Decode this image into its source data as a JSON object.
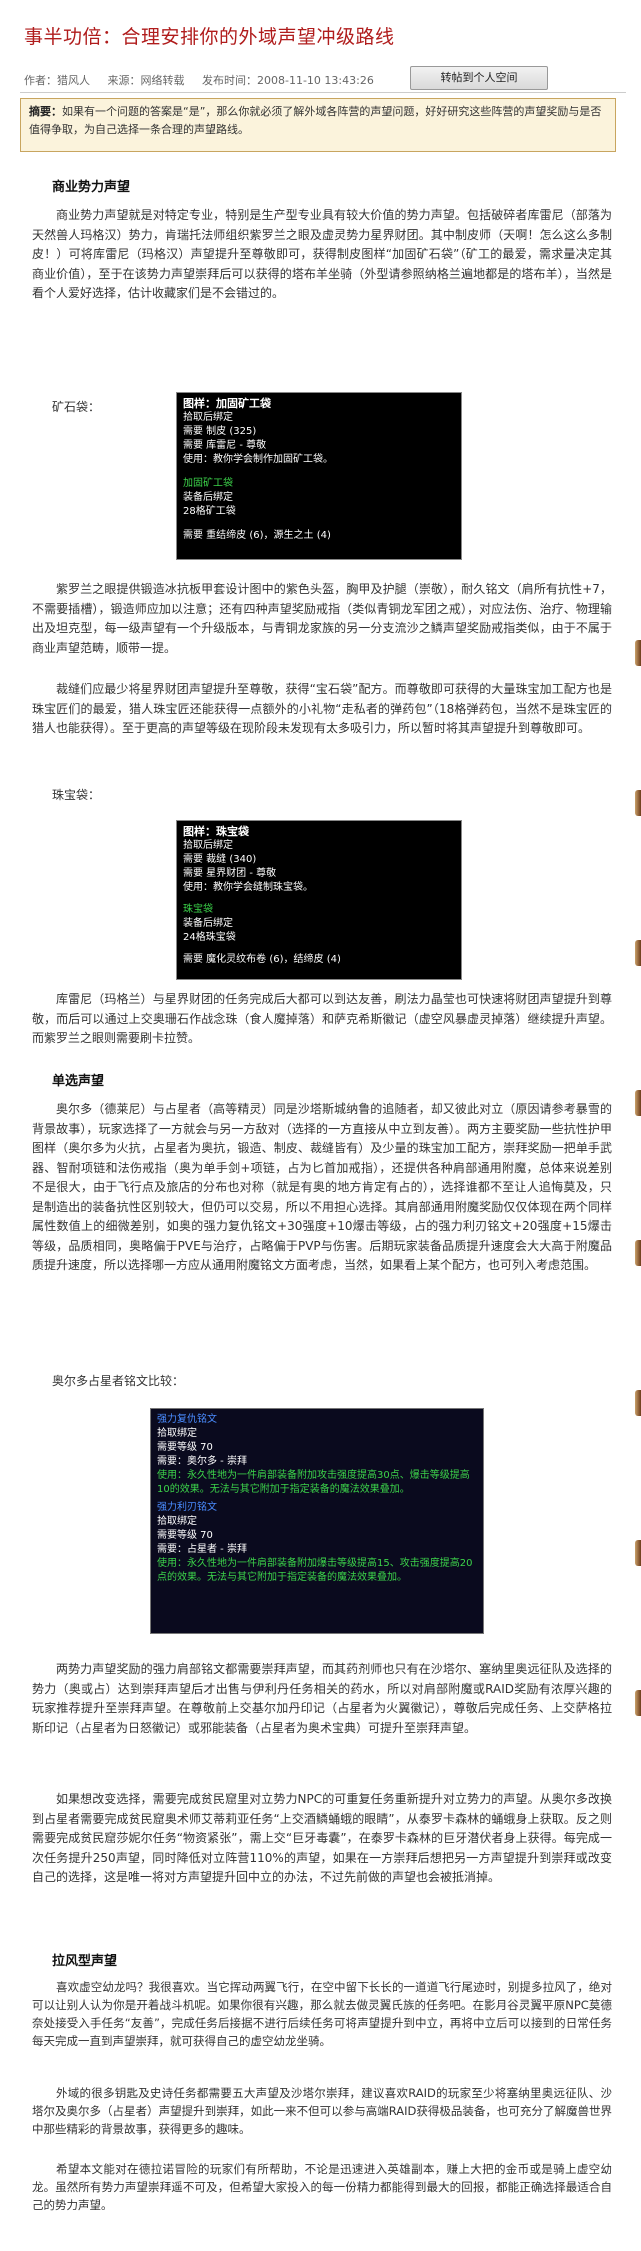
{
  "title": "事半功倍：合理安排你的外域声望冲级路线",
  "meta": {
    "author": "作者：猎风人",
    "source": "来源：网络转载",
    "time": "发布时间：2008-11-10 13:43:26",
    "save_button": "转帖到个人空间"
  },
  "summary": {
    "label": "摘要：",
    "text": "如果有一个问题的答案是“是”，那么你就必须了解外域各阵营的声望问题，好好研究这些阵营的声望奖励与是否值得争取，为自己选择一条合理的声望路线。"
  },
  "sections": {
    "business_heading": "商业势力声望",
    "business_p1": "商业势力声望就是对特定专业，特别是生产型专业具有较大价值的势力声望。包括破碎者库雷尼（部落为天然兽人玛格汉）势力，肯瑞托法师组织紫罗兰之眼及虚灵势力星界财团。其中制皮师（天啊！怎么这么多制皮！）可将库雷尼（玛格汉）声望提升至尊敬即可，获得制皮图样“加固矿石袋”（矿工的最爱，需求量决定其商业价值），至于在该势力声望崇拜后可以获得的塔布羊坐骑（外型请参照纳格兰遍地都是的塔布羊），当然是看个人爱好选择，估计收藏家们是不会错过的。",
    "ore_bag_label": "矿石袋：",
    "tip1": {
      "title": "图样：加固矿工袋",
      "l1": "拾取后绑定",
      "l2": "需要 制皮 (325)",
      "l3": "需要 库雷尼 - 尊敬",
      "l4": "使用：教你学会制作加固矿工袋。",
      "g1": "加固矿工袋",
      "g2": "装备后绑定",
      "g3": "28格矿工袋",
      "l5": "需要 重结缔皮 (6)，源生之土 (4)"
    },
    "business_p2": "紫罗兰之眼提供锻造冰抗板甲套设计图中的紫色头盔，胸甲及护腿（崇敬），耐久铭文（肩所有抗性+7，不需要插槽），锻造师应加以注意；还有四种声望奖励戒指（类似青铜龙军团之戒），对应法伤、治疗、物理输出及坦克型，每一级声望有一个升级版本，与青铜龙家族的另一分支流沙之鳞声望奖励戒指类似，由于不属于商业声望范畴，顺带一提。",
    "business_p3": "裁缝们应最少将星界财团声望提升至尊敬，获得“宝石袋”配方。而尊敬即可获得的大量珠宝加工配方也是珠宝匠们的最爱，猎人珠宝匠还能获得一点额外的小礼物“走私者的弹药包”（18格弹药包，当然不是珠宝匠的猎人也能获得）。至于更高的声望等级在现阶段未发现有太多吸引力，所以暂时将其声望提升到尊敬即可。",
    "gem_bag_label": "珠宝袋：",
    "tip2": {
      "title": "图样：珠宝袋",
      "l1": "拾取后绑定",
      "l2": "需要 裁缝 (340)",
      "l3": "需要 星界财团 - 尊敬",
      "l4": "使用：教你学会缝制珠宝袋。",
      "g1": "珠宝袋",
      "g2": "装备后绑定",
      "g3": "24格珠宝袋",
      "l5": "需要 魔化灵纹布卷 (6)，结缔皮 (4)"
    },
    "business_p4": "库雷尼（玛格兰）与星界财团的任务完成后大都可以到达友善，刷法力晶莹也可快速将财团声望提升到尊敬，而后可以通过上交奥珊石作战念珠（食人魔掉落）和萨克希斯徽记（虚空风暴虚灵掉落）继续提升声望。而紫罗兰之眼则需要刷卡拉赞。",
    "single_heading": "单选声望",
    "single_p1": "奥尔多（德莱尼）与占星者（高等精灵）同是沙塔斯城纳鲁的追随者，却又彼此对立（原因请参考暴雪的背景故事），玩家选择了一方就会与另一方敌对（选择的一方直接从中立到友善）。两方主要奖励一些抗性护甲图样（奥尔多为火抗，占星者为奥抗，锻造、制皮、裁缝皆有）及少量的珠宝加工配方，崇拜奖励一把单手武器、智耐项链和法伤戒指（奥为单手剑+项链，占为匕首加戒指），还提供各种肩部通用附魔，总体来说差别不是很大，由于飞行点及旅店的分布也对称（就是有奥的地方肯定有占的），选择谁都不至让人追悔莫及，只是制造出的装备抗性区别较大，但仍可以交易，所以不用担心选择。其肩部通用附魔奖励仅仅体现在两个同样属性数值上的细微差别，如奥的强力复仇铭文+30强度+10爆击等级，占的强力利刃铭文+20强度+15爆击等级，品质相同，奥略偏于PVE与治疗，占略偏于PVP与伤害。后期玩家装备品质提升速度会大大高于附魔品质提升速度，所以选择哪一方应从通用附魔铭文方面考虑，当然，如果看上某个配方，也可列入考虑范围。",
    "compare_label": "奥尔多占星者铭文比较：",
    "tip3": {
      "a_title": "强力复仇铭文",
      "a1": "拾取绑定",
      "a2": "需要等级 70",
      "a3": "需要：奥尔多 - 崇拜",
      "a4": "使用：永久性地为一件肩部装备附加攻击强度提高30点、爆击等级提高10的效果。无法与其它附加于指定装备的魔法效果叠加。",
      "b_title": "强力利刃铭文",
      "b1": "拾取绑定",
      "b2": "需要等级 70",
      "b3": "需要：占星者 - 崇拜",
      "b4": "使用：永久性地为一件肩部装备附加爆击等级提高15、攻击强度提高20点的效果。无法与其它附加于指定装备的魔法效果叠加。"
    },
    "single_p2": "两势力声望奖励的强力肩部铭文都需要崇拜声望，而其药剂师也只有在沙塔尔、塞纳里奥远征队及选择的势力（奥或占）达到崇拜声望后才出售与伊利丹任务相关的药水，所以对肩部附魔或RAID奖励有浓厚兴趣的玩家推荐提升至崇拜声望。在尊敬前上交基尔加丹印记（占星者为火翼徽记），尊敬后完成任务、上交萨格拉斯印记（占星者为日怒徽记）或邪能装备（占星者为奥术宝典）可提升至崇拜声望。",
    "single_p3": "如果想改变选择，需要完成贫民窟里对立势力NPC的可重复任务重新提升对立势力的声望。从奥尔多改换到占星者需要完成贫民窟奥术师艾蒂莉亚任务“上交酒鳞蛹蛾的眼睛”，从泰罗卡森林的蛹蛾身上获取。反之则需要完成贫民窟莎妮尔任务“物资紧张”，需上交“巨牙毒囊”，在泰罗卡森林的巨牙潜伏者身上获得。每完成一次任务提升250声望，同时降低对立阵营110%的声望，如果在一方崇拜后想把另一方声望提升到崇拜或改变自己的选择，这是唯一将对方声望提升回中立的办法，不过先前做的声望也会被抵消掉。",
    "pull_heading": "拉风型声望",
    "pull_p1": "喜欢虚空幼龙吗？我很喜欢。当它挥动两翼飞行，在空中留下长长的一道道飞行尾迹时，别提多拉风了，绝对可以让别人认为你是开着战斗机呢。如果你很有兴趣，那么就去做灵翼氏族的任务吧。在影月谷灵翼平原NPC莫德奈处接受入手任务“友善”，完成任务后接据不进行后续任务可将声望提升到中立，再将中立后可以接到的日常任务每天完成一直到声望崇拜，就可获得自己的虚空幼龙坐骑。",
    "pull_p2": "外域的很多钥匙及史诗任务都需要五大声望及沙塔尔崇拜，建议喜欢RAID的玩家至少将塞纳里奥远征队、沙塔尔及奥尔多（占星者）声望提升到崇拜，如此一来不但可以参与高端RAID获得极品装备，也可充分了解魔兽世界中那些精彩的背景故事，获得更多的趣味。",
    "pull_p3": "希望本文能对在德拉诺冒险的玩家们有所帮助，不论是迅速进入英雄副本，赚上大把的金币或是骑上虚空幼龙。虽然所有势力声望崇拜遥不可及，但希望大家投入的每一份精力都能得到最大的回报，都能正确选择最适合自己的势力声望。"
  }
}
